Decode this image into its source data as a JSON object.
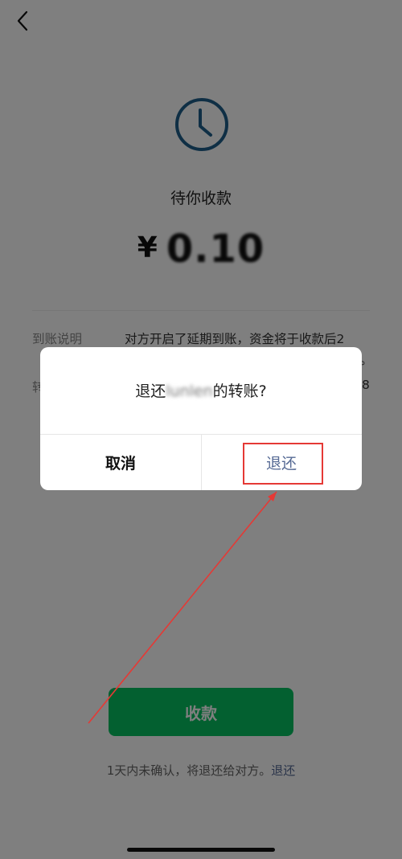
{
  "header": {
    "back_icon": "chevron-left-icon"
  },
  "status": {
    "icon": "clock-icon",
    "accent_color": "#1f5f8b",
    "text": "待你收款"
  },
  "amount": {
    "currency": "¥",
    "value": "0.10"
  },
  "details": {
    "arrival_label": "到账说明",
    "arrival_value": "对方开启了延期到账，资金将于收款后2",
    "arrival_value_overflow": "。",
    "transfer_label_partial": "转",
    "transfer_value_partial": "8"
  },
  "actions": {
    "collect_label": "收款",
    "collect_color": "#07c160"
  },
  "footer": {
    "note": "1天内未确认，将退还给对方。",
    "link": "退还"
  },
  "dialog": {
    "title_prefix": "退还",
    "title_name": "lunlen",
    "title_suffix": "的转账?",
    "cancel_label": "取消",
    "confirm_label": "退还",
    "confirm_color": "#576b95"
  },
  "annotation": {
    "color": "#e53935"
  }
}
